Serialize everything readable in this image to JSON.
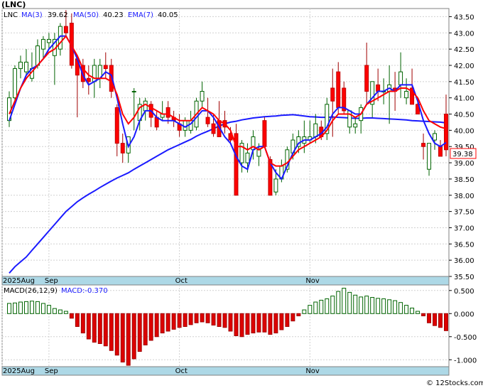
{
  "chart_data": [
    {
      "type": "candlestick",
      "title": "(LNC)",
      "legend": {
        "ticker": "LNC",
        "items": [
          {
            "label": "MA(3)",
            "value": "39.62",
            "color": "#1a1aff"
          },
          {
            "label": "MA(50)",
            "value": "40.23",
            "color": "#1a1aff"
          },
          {
            "label": "EMA(7)",
            "value": "40.05",
            "color": "#ff0000"
          }
        ]
      },
      "last_price_label": "39.38",
      "ylim": [
        35.5,
        43.75
      ],
      "y_ticks": [
        "35.50",
        "36.00",
        "36.50",
        "37.00",
        "37.50",
        "38.00",
        "38.50",
        "39.00",
        "39.50",
        "40.00",
        "40.50",
        "41.00",
        "41.50",
        "42.00",
        "42.50",
        "43.00",
        "43.50"
      ],
      "x_labels": [
        {
          "text": "2025Aug",
          "index": 0
        },
        {
          "text": "Sep",
          "index": 7
        },
        {
          "text": "Oct",
          "index": 30
        },
        {
          "text": "Nov",
          "index": 53
        }
      ],
      "colors": {
        "up": "#008000",
        "down": "#ff0000",
        "ma": "#1a1aff",
        "ema": "#ff0000",
        "axis_band": "#add8e6"
      },
      "candles": [
        [
          40.3,
          41.2,
          40.1,
          41.0
        ],
        [
          41.0,
          42.0,
          40.9,
          41.9
        ],
        [
          41.9,
          42.3,
          41.6,
          42.1
        ],
        [
          41.8,
          42.5,
          41.7,
          42.1
        ],
        [
          41.6,
          42.4,
          41.5,
          41.9
        ],
        [
          42.0,
          42.8,
          41.9,
          42.6
        ],
        [
          42.5,
          42.9,
          42.2,
          42.8
        ],
        [
          42.7,
          43.0,
          42.5,
          42.8
        ],
        [
          42.3,
          43.0,
          41.4,
          42.8
        ],
        [
          42.5,
          43.3,
          42.3,
          43.2
        ],
        [
          43.2,
          43.7,
          42.9,
          43.0
        ],
        [
          43.3,
          43.6,
          41.9,
          42.0
        ],
        [
          42.2,
          42.3,
          40.4,
          41.7
        ],
        [
          42.0,
          42.2,
          41.3,
          41.5
        ],
        [
          41.6,
          42.0,
          41.1,
          41.5
        ],
        [
          41.5,
          42.2,
          41.0,
          42.0
        ],
        [
          41.6,
          42.2,
          41.3,
          42.0
        ],
        [
          42.0,
          42.4,
          41.6,
          41.9
        ],
        [
          42.0,
          42.2,
          41.0,
          41.2
        ],
        [
          40.7,
          40.8,
          39.2,
          39.6
        ],
        [
          39.6,
          39.9,
          39.0,
          39.3
        ],
        [
          39.3,
          39.7,
          39.0,
          39.8
        ],
        [
          41.2,
          41.3,
          40.0,
          41.2
        ],
        [
          40.3,
          41.0,
          40.0,
          40.8
        ],
        [
          40.6,
          41.0,
          40.3,
          40.9
        ],
        [
          40.8,
          40.9,
          40.1,
          40.4
        ],
        [
          40.4,
          40.6,
          40.0,
          40.1
        ],
        [
          40.4,
          40.9,
          40.3,
          40.5
        ],
        [
          40.7,
          40.9,
          40.2,
          40.4
        ],
        [
          40.4,
          40.6,
          40.1,
          40.3
        ],
        [
          40.2,
          40.5,
          39.8,
          40.0
        ],
        [
          40.0,
          40.4,
          39.8,
          40.3
        ],
        [
          40.0,
          40.6,
          39.9,
          40.3
        ],
        [
          40.1,
          41.0,
          40.0,
          40.9
        ],
        [
          40.9,
          41.5,
          40.7,
          41.2
        ],
        [
          40.4,
          41.0,
          40.1,
          40.2
        ],
        [
          40.2,
          40.5,
          39.8,
          39.9
        ],
        [
          40.3,
          40.9,
          39.8,
          39.8
        ],
        [
          40.3,
          40.6,
          39.9,
          40.1
        ],
        [
          39.9,
          40.1,
          39.6,
          39.7
        ],
        [
          39.9,
          40.2,
          38.0,
          38.0
        ],
        [
          39.0,
          39.7,
          38.7,
          39.6
        ],
        [
          39.0,
          39.6,
          38.7,
          39.3
        ],
        [
          39.4,
          40.0,
          39.1,
          39.8
        ],
        [
          39.2,
          39.6,
          38.9,
          39.4
        ],
        [
          40.3,
          40.4,
          39.5,
          39.5
        ],
        [
          39.1,
          39.2,
          38.0,
          38.0
        ],
        [
          38.1,
          38.8,
          38.0,
          38.5
        ],
        [
          38.5,
          39.1,
          38.4,
          38.9
        ],
        [
          38.8,
          39.5,
          38.7,
          39.4
        ],
        [
          39.3,
          39.9,
          39.1,
          39.7
        ],
        [
          39.5,
          40.0,
          39.3,
          39.8
        ],
        [
          39.6,
          40.3,
          39.3,
          39.8
        ],
        [
          39.7,
          40.3,
          39.6,
          39.8
        ],
        [
          39.8,
          40.5,
          39.6,
          40.2
        ],
        [
          40.1,
          40.3,
          39.7,
          39.8
        ],
        [
          39.9,
          41.0,
          39.7,
          40.8
        ],
        [
          41.3,
          41.9,
          39.8,
          40.9
        ],
        [
          41.8,
          42.1,
          40.5,
          40.7
        ],
        [
          41.3,
          41.5,
          40.5,
          40.6
        ],
        [
          40.1,
          40.6,
          39.9,
          40.6
        ],
        [
          40.1,
          40.4,
          39.9,
          40.2
        ],
        [
          40.3,
          40.8,
          39.9,
          40.7
        ],
        [
          42.0,
          42.7,
          40.8,
          41.2
        ],
        [
          40.8,
          41.5,
          40.4,
          41.5
        ],
        [
          41.4,
          41.9,
          40.9,
          41.2
        ],
        [
          41.2,
          41.6,
          40.8,
          41.2
        ],
        [
          41.2,
          42.0,
          40.2,
          41.4
        ],
        [
          41.3,
          41.8,
          40.6,
          41.2
        ],
        [
          41.4,
          42.4,
          41.0,
          41.8
        ],
        [
          41.0,
          41.6,
          40.8,
          41.2
        ],
        [
          41.3,
          41.9,
          40.8,
          40.8
        ],
        [
          40.8,
          41.0,
          40.5,
          40.5
        ],
        [
          39.6,
          39.9,
          39.1,
          39.5
        ],
        [
          38.8,
          39.6,
          38.6,
          39.6
        ],
        [
          39.7,
          40.0,
          39.4,
          39.9
        ],
        [
          39.5,
          39.7,
          39.2,
          39.2
        ],
        [
          40.5,
          41.1,
          39.2,
          39.4
        ]
      ],
      "ma3": [
        40.3,
        40.8,
        41.3,
        41.7,
        41.9,
        42.0,
        42.2,
        42.5,
        42.7,
        42.9,
        42.9,
        42.6,
        42.2,
        41.7,
        41.4,
        41.5,
        41.6,
        41.8,
        41.7,
        41.0,
        40.2,
        39.5,
        39.8,
        40.3,
        40.6,
        40.6,
        40.4,
        40.3,
        40.3,
        40.3,
        40.2,
        40.1,
        40.2,
        40.4,
        40.6,
        40.6,
        40.4,
        40.1,
        39.8,
        39.6,
        39.2,
        38.9,
        38.8,
        39.4,
        39.5,
        39.5,
        39.0,
        38.7,
        38.5,
        38.9,
        39.3,
        39.6,
        39.7,
        39.7,
        39.8,
        39.9,
        40.1,
        40.5,
        40.7,
        40.7,
        40.6,
        40.5,
        40.5,
        40.8,
        41.0,
        41.2,
        41.2,
        41.3,
        41.2,
        41.4,
        41.4,
        41.4,
        40.9,
        40.3,
        39.9,
        39.6,
        39.5,
        39.62
      ],
      "ma50": [
        35.6,
        35.8,
        35.95,
        36.1,
        36.3,
        36.5,
        36.7,
        36.9,
        37.1,
        37.3,
        37.5,
        37.65,
        37.8,
        37.92,
        38.03,
        38.13,
        38.24,
        38.34,
        38.44,
        38.53,
        38.61,
        38.69,
        38.8,
        38.9,
        39.0,
        39.1,
        39.2,
        39.3,
        39.4,
        39.48,
        39.56,
        39.64,
        39.72,
        39.82,
        39.9,
        39.97,
        40.05,
        40.13,
        40.2,
        40.25,
        40.28,
        40.32,
        40.35,
        40.38,
        40.4,
        40.42,
        40.43,
        40.44,
        40.46,
        40.47,
        40.48,
        40.46,
        40.44,
        40.42,
        40.41,
        40.4,
        40.4,
        40.41,
        40.4,
        40.39,
        40.38,
        40.37,
        40.37,
        40.38,
        40.38,
        40.37,
        40.36,
        40.35,
        40.34,
        40.33,
        40.32,
        40.3,
        40.29,
        40.28,
        40.27,
        40.26,
        40.25,
        40.23
      ],
      "ema7": [
        40.5,
        40.9,
        41.3,
        41.6,
        41.8,
        42.0,
        42.2,
        42.4,
        42.5,
        42.7,
        42.9,
        42.6,
        42.3,
        41.9,
        41.7,
        41.6,
        41.6,
        41.6,
        41.5,
        41.1,
        40.5,
        40.2,
        40.4,
        40.7,
        40.8,
        40.7,
        40.6,
        40.5,
        40.5,
        40.4,
        40.3,
        40.3,
        40.3,
        40.5,
        40.7,
        40.6,
        40.5,
        40.3,
        40.2,
        40.0,
        39.5,
        39.5,
        39.4,
        39.5,
        39.4,
        39.5,
        39.0,
        38.9,
        38.9,
        39.0,
        39.2,
        39.4,
        39.5,
        39.6,
        39.7,
        39.8,
        40.0,
        40.3,
        40.5,
        40.5,
        40.5,
        40.4,
        40.5,
        40.8,
        40.9,
        41.0,
        41.1,
        41.2,
        41.2,
        41.3,
        41.3,
        41.2,
        41.0,
        40.6,
        40.3,
        40.2,
        40.1,
        40.05
      ]
    },
    {
      "type": "bar",
      "title": "MACD(26,12,9)",
      "value_label": "MACD:-0.370",
      "ylim": [
        -1.15,
        0.62
      ],
      "y_ticks": [
        "0.500",
        "0.000",
        "-0.500",
        "-1.000"
      ],
      "x_labels": [
        {
          "text": "2025Aug",
          "index": 0
        },
        {
          "text": "Sep",
          "index": 7
        },
        {
          "text": "Oct",
          "index": 30
        },
        {
          "text": "Nov",
          "index": 53
        }
      ],
      "values": [
        0.22,
        0.23,
        0.25,
        0.26,
        0.27,
        0.26,
        0.22,
        0.18,
        0.11,
        0.08,
        0.05,
        -0.1,
        -0.28,
        -0.42,
        -0.55,
        -0.62,
        -0.65,
        -0.7,
        -0.8,
        -0.9,
        -1.05,
        -1.12,
        -0.98,
        -0.82,
        -0.68,
        -0.58,
        -0.5,
        -0.42,
        -0.38,
        -0.34,
        -0.3,
        -0.28,
        -0.24,
        -0.2,
        -0.18,
        -0.2,
        -0.25,
        -0.28,
        -0.3,
        -0.38,
        -0.48,
        -0.5,
        -0.45,
        -0.42,
        -0.4,
        -0.4,
        -0.45,
        -0.42,
        -0.35,
        -0.28,
        -0.16,
        -0.05,
        0.08,
        0.18,
        0.25,
        0.29,
        0.32,
        0.38,
        0.48,
        0.55,
        0.46,
        0.4,
        0.36,
        0.38,
        0.35,
        0.33,
        0.32,
        0.3,
        0.28,
        0.24,
        0.18,
        0.12,
        0.05,
        -0.05,
        -0.2,
        -0.26,
        -0.3,
        -0.37
      ]
    }
  ],
  "watermark": "© 12Stocks.com"
}
